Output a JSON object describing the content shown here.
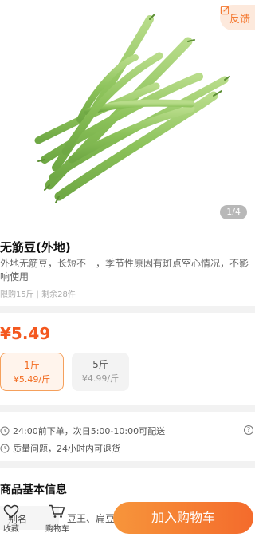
{
  "hero": {
    "feedback_label": "反馈",
    "pager": "1/4"
  },
  "product": {
    "title": "无筋豆(外地)",
    "description": "外地无筋豆，长短不一，季节性原因有斑点空心情况，不影响使用",
    "purchase_limit": "限购15斤",
    "remaining": "剩余28件",
    "price": "¥5.49"
  },
  "specs": [
    {
      "name": "1斤",
      "price": "¥5.49/斤",
      "selected": true
    },
    {
      "name": "5斤",
      "price": "¥4.99/斤",
      "selected": false
    }
  ],
  "delivery": {
    "line1": "24:00前下单，次日5:00-10:00可配送",
    "line2": "质量问题，24小时内可退货"
  },
  "attributes": {
    "section_title": "商品基本信息",
    "key": "别名",
    "value": "豆王、扁豆、四季豆"
  },
  "bottom_bar": {
    "favorite_label": "收藏",
    "cart_label": "购物车",
    "add_to_cart_label": "加入购物车"
  },
  "colors": {
    "accent": "#f46b2c",
    "price": "#f4581f",
    "selected_bg": "#fff4ec",
    "feedback_bg": "#fde9dc"
  }
}
